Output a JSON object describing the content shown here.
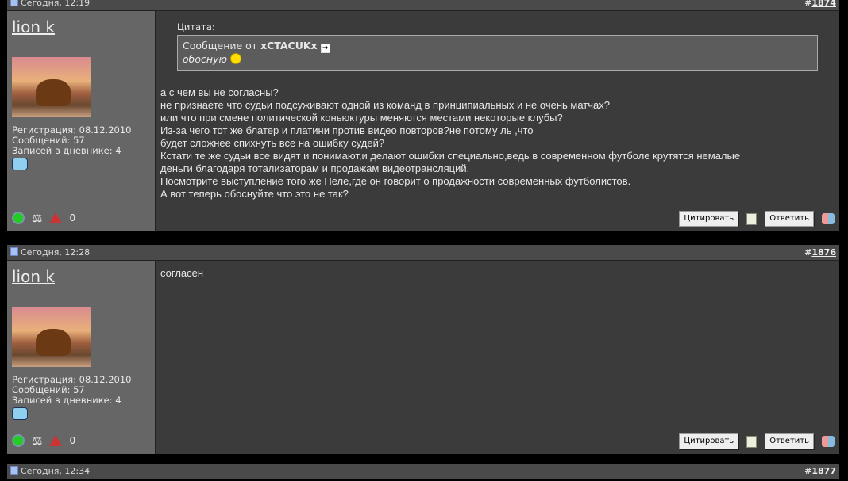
{
  "posts": [
    {
      "date": "Сегодня, 12:19",
      "hash": "#",
      "number": "1874",
      "user": "lion k",
      "reg": "Регистрация: 08.12.2010",
      "msgs": "Сообщений: 57",
      "diary_label": "Записей в дневнике: ",
      "diary_count": "4",
      "quote": {
        "label": "Цитата:",
        "from_prefix": "Сообщение от ",
        "author": "xCTACUKx",
        "text": "обосную"
      },
      "message": "а с чем вы не согласны?\nне признаете что судьи подсуживают одной из команд в принципиальных и не очень матчах?\nили что при смене политической коньюктуры меняются местами некоторые клубы?\nИз-за чего тот же блатер и платини против видео повторов?не потому ль ,что\nбудет сложнее спихнуть все на ошибку судей?\nКстати те же судьи все видят и понимают,и делают ошибки специально,ведь в современном футболе крутятся немалые\nденьги благодаря тотализаторам и продажам видеотрансляций.\nПосмотрите выступление того же Пеле,где он говорит о продажности современных футболистов.\nА вот теперь обоснуйте что это не так?"
    },
    {
      "date": "Сегодня, 12:28",
      "hash": "#",
      "number": "1876",
      "user": "lion k",
      "reg": "Регистрация: 08.12.2010",
      "msgs": "Сообщений: 57",
      "diary_label": "Записей в дневнике: ",
      "diary_count": "4",
      "message": "согласен"
    },
    {
      "date": "Сегодня, 12:34",
      "hash": "#",
      "number": "1877"
    }
  ],
  "buttons": {
    "quote": "Цитировать",
    "reply": "Ответить"
  }
}
